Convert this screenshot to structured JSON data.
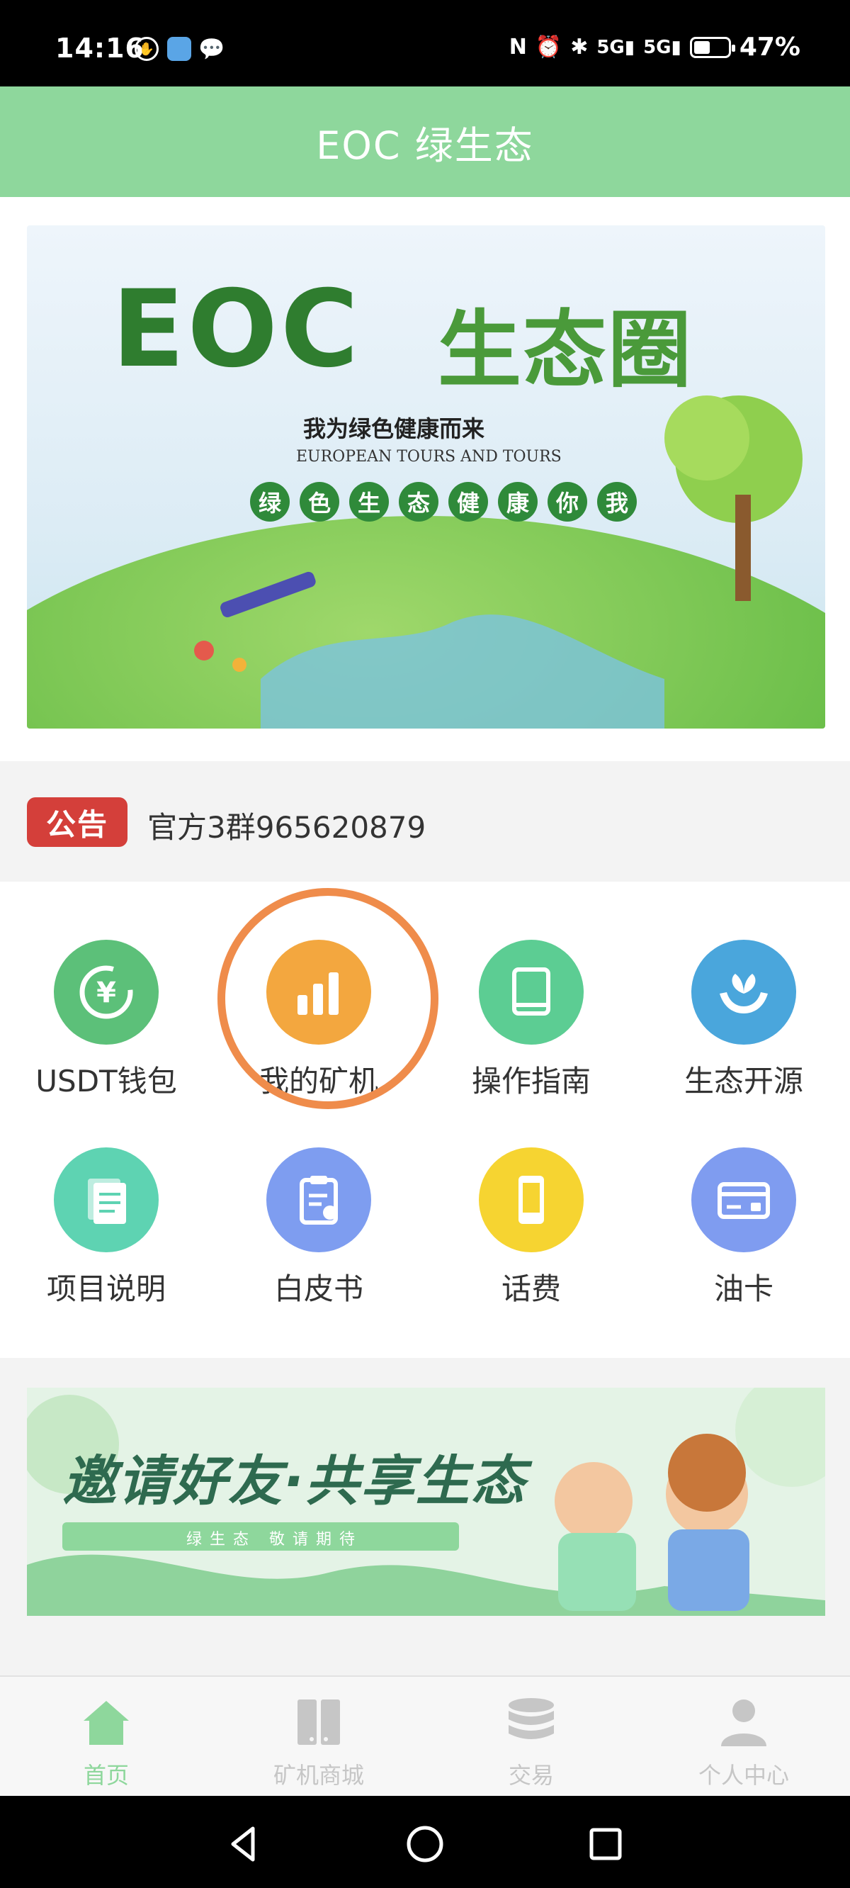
{
  "status_bar": {
    "time": "14:16",
    "battery": "47%",
    "battery_level": 0.47
  },
  "header": {
    "title": "EOC 绿生态"
  },
  "banner": {
    "title_left": "EOC",
    "title_right": "生态圈",
    "slogan": "我为绿色健康而来",
    "subtitle": "EUROPEAN TOURS AND TOURS",
    "circle_chars": [
      "绿",
      "色",
      "生",
      "态",
      "健",
      "康",
      "你",
      "我"
    ]
  },
  "notice": {
    "badge": "公告",
    "text": "官方3群965620879"
  },
  "grid": {
    "items": [
      {
        "label": "USDT钱包",
        "icon": "usdt-wallet-icon",
        "color": "#5cc079"
      },
      {
        "label": "我的矿机",
        "icon": "bar-chart-icon",
        "color": "#f3a73f"
      },
      {
        "label": "操作指南",
        "icon": "book-icon",
        "color": "#5ccd93"
      },
      {
        "label": "生态开源",
        "icon": "sprout-hands-icon",
        "color": "#4aa6dc"
      },
      {
        "label": "项目说明",
        "icon": "document-icon",
        "color": "#5ed3b2"
      },
      {
        "label": "白皮书",
        "icon": "clipboard-icon",
        "color": "#7e9df0"
      },
      {
        "label": "话费",
        "icon": "phone-icon",
        "color": "#f6d431"
      },
      {
        "label": "油卡",
        "icon": "card-icon",
        "color": "#7f9cf0"
      }
    ]
  },
  "invite": {
    "title": "邀请好友·共享生态",
    "ribbon": "绿 生 态   敬 请 期 待"
  },
  "bottom_nav": {
    "items": [
      {
        "label": "首页",
        "icon": "home-icon",
        "active": true
      },
      {
        "label": "矿机商城",
        "icon": "shop-icon",
        "active": false
      },
      {
        "label": "交易",
        "icon": "coins-icon",
        "active": false
      },
      {
        "label": "个人中心",
        "icon": "user-icon",
        "active": false
      }
    ]
  },
  "colors": {
    "header": "#8ed79c",
    "badge": "#d43f3a",
    "highlight": "#ef8c4b",
    "nav_active": "#8ed79c",
    "nav_inactive": "#c6c6c6"
  }
}
